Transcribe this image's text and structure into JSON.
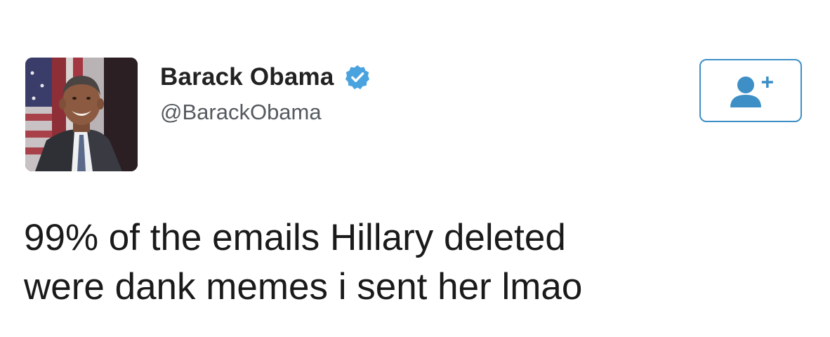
{
  "author": {
    "display_name": "Barack Obama",
    "handle": "@BarackObama",
    "verified": true,
    "verified_icon": "verified-badge-icon",
    "avatar": "avatar-photo"
  },
  "follow_button": {
    "icon": "add-user-icon"
  },
  "tweet": {
    "lines": [
      "99% of the emails Hillary deleted",
      "were dank memes i sent her lmao"
    ]
  },
  "colors": {
    "accent": "#3d8fc6",
    "verified": "#4aa3df",
    "text": "#1a1a1a",
    "handle": "#555a60"
  }
}
